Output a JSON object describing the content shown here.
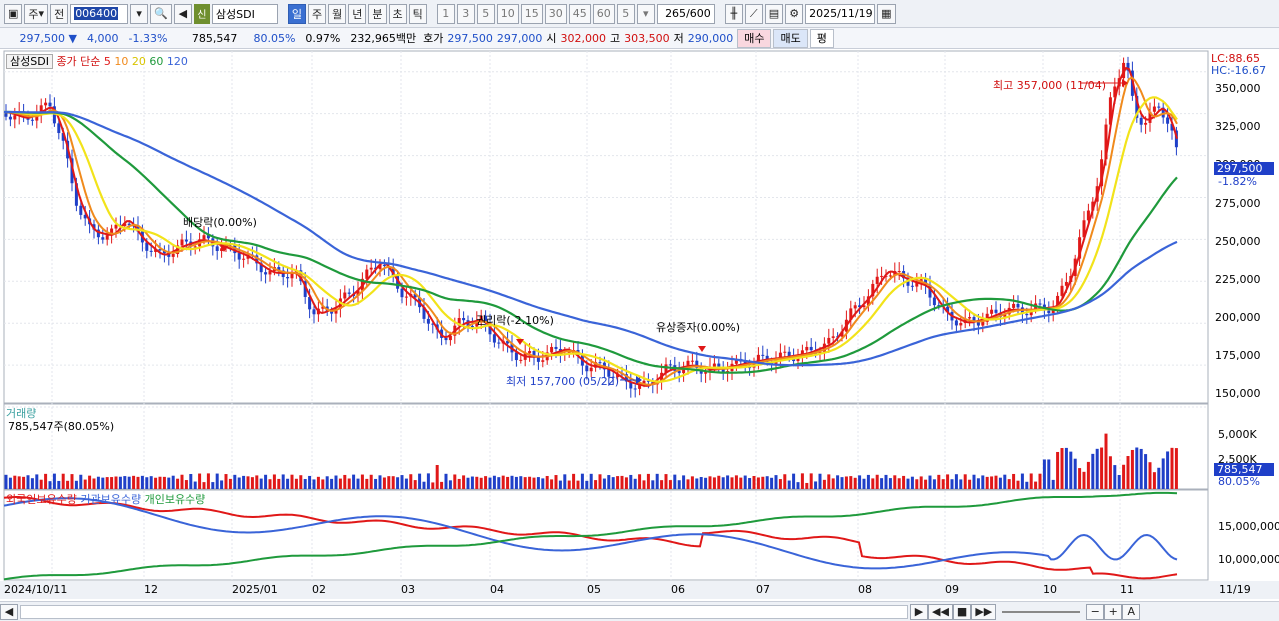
{
  "toolbar": {
    "type_label": "주",
    "prev_label": "전",
    "code": "006400",
    "sin_badge": "신",
    "stock_name": "삼성SDI",
    "periods": [
      "일",
      "주",
      "월",
      "년",
      "분",
      "초",
      "틱"
    ],
    "nums": [
      "1",
      "3",
      "5",
      "10",
      "15",
      "30",
      "45",
      "60"
    ],
    "count_select": "5",
    "range": "265",
    "range_max": "/600",
    "date": "2025/11/19"
  },
  "quote": {
    "price": "297,500",
    "change": "4,000",
    "change_pct": "-1.33%",
    "volume": "785,547",
    "vol_ratio": "80.05%",
    "turnover_pct": "0.97%",
    "amount": "232,965백만",
    "hoga_label": "호가",
    "ask": "297,500",
    "bid": "297,000",
    "open_label": "시",
    "open": "302,000",
    "high_label": "고",
    "high": "303,500",
    "low_label": "저",
    "low": "290,000",
    "buy": "매수",
    "sell": "매도",
    "pyeong": "평"
  },
  "price_panel": {
    "stock_tag": "삼성SDI",
    "ma_title": "종가 단순",
    "ma_periods": [
      "5",
      "10",
      "20",
      "60",
      "120"
    ],
    "lc": "LC:88.65",
    "hc": "HC:-16.67",
    "y_ticks": [
      "350,000",
      "325,000",
      "300,000",
      "275,000",
      "250,000",
      "225,000",
      "200,000",
      "175,000",
      "150,000"
    ],
    "current_price": "297,500",
    "current_pct": "-1.82%",
    "max_label": "최고 357,000 (11/04)",
    "min_label": "최저 157,700 (05/22)",
    "events": [
      "배당락(0.00%)",
      "권리락(-2.10%)",
      "유상증자(0.00%)"
    ]
  },
  "volume_panel": {
    "title": "거래량",
    "value": "785,547주(80.05%)",
    "y_ticks": [
      "5,000K",
      "2,500K"
    ],
    "current": "785,547",
    "pct": "80.05%"
  },
  "holding_panel": {
    "legends": [
      "외국인보유수량",
      "기관보유수량",
      "개인보유수량"
    ],
    "y_ticks": [
      "15,000,000",
      "10,000,000"
    ]
  },
  "x_labels": [
    "2024/10/11",
    "12",
    "2025/01",
    "02",
    "03",
    "04",
    "05",
    "06",
    "07",
    "08",
    "09",
    "10",
    "11"
  ],
  "x_last": "11/19",
  "colors": {
    "ma5": "#e01818",
    "ma10": "#f08a1c",
    "ma20": "#f2e31a",
    "ma60": "#1f9a3c",
    "ma120": "#3a64d8",
    "up": "#e01818",
    "down": "#1f3fc8"
  },
  "chart_data": {
    "type": "candlestick",
    "price_range": [
      150000,
      360000
    ],
    "max": 357000,
    "min": 157700,
    "close_series_sample": [
      326000,
      310000,
      265000,
      253000,
      260000,
      248000,
      245000,
      232000,
      210000,
      228000,
      235000,
      212000,
      188000,
      185000,
      178000,
      168000,
      163000,
      172000,
      175000,
      180000,
      178000,
      196000,
      226000,
      210000,
      200000,
      203000,
      205000,
      250000,
      320000,
      340000,
      322000,
      297500
    ]
  }
}
